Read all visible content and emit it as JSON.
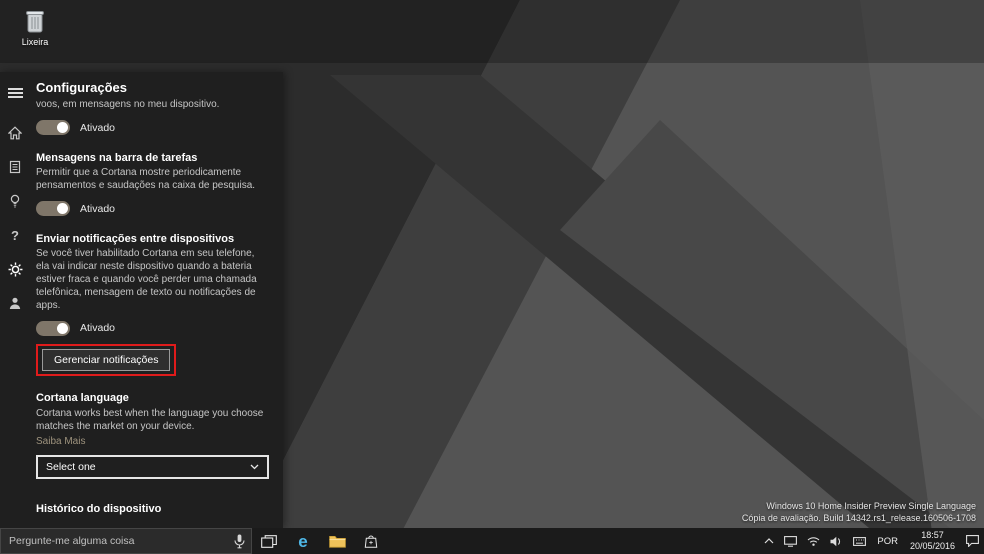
{
  "desktop": {
    "recycle_bin_label": "Lixeira",
    "watermark_line1": "Windows 10 Home Insider Preview Single Language",
    "watermark_line2": "Cópia de avaliação. Build 14342.rs1_release.160506-1708"
  },
  "panel": {
    "title": "Configurações",
    "help_glyph": "?",
    "intro": {
      "tail_text": "voos, em mensagens no meu dispositivo.",
      "toggle_label": "Ativado"
    },
    "taskbar_messages": {
      "title": "Mensagens na barra de tarefas",
      "desc": "Permitir que a Cortana mostre periodicamente pensamentos e saudações na caixa de pesquisa.",
      "toggle_label": "Ativado"
    },
    "notifications": {
      "title": "Enviar notificações entre dispositivos",
      "desc": "Se você tiver habilitado Cortana em seu telefone, ela vai indicar neste dispositivo quando a bateria estiver fraca e quando você perder uma chamada telefônica, mensagem de texto ou notificações de apps.",
      "toggle_label": "Ativado",
      "manage_button_label": "Gerenciar notificações"
    },
    "language": {
      "title": "Cortana language",
      "desc": "Cortana works best when the language you choose matches the market on your device.",
      "learn_more_label": "Saiba Mais",
      "select_value": "Select one"
    },
    "device_history": {
      "title": "Histórico do dispositivo"
    }
  },
  "taskbar": {
    "search_placeholder": "Pergunte-me alguma coisa",
    "edge_letter": "e",
    "language_indicator": "POR",
    "clock_time": "18:57",
    "clock_date": "20/05/2016"
  }
}
